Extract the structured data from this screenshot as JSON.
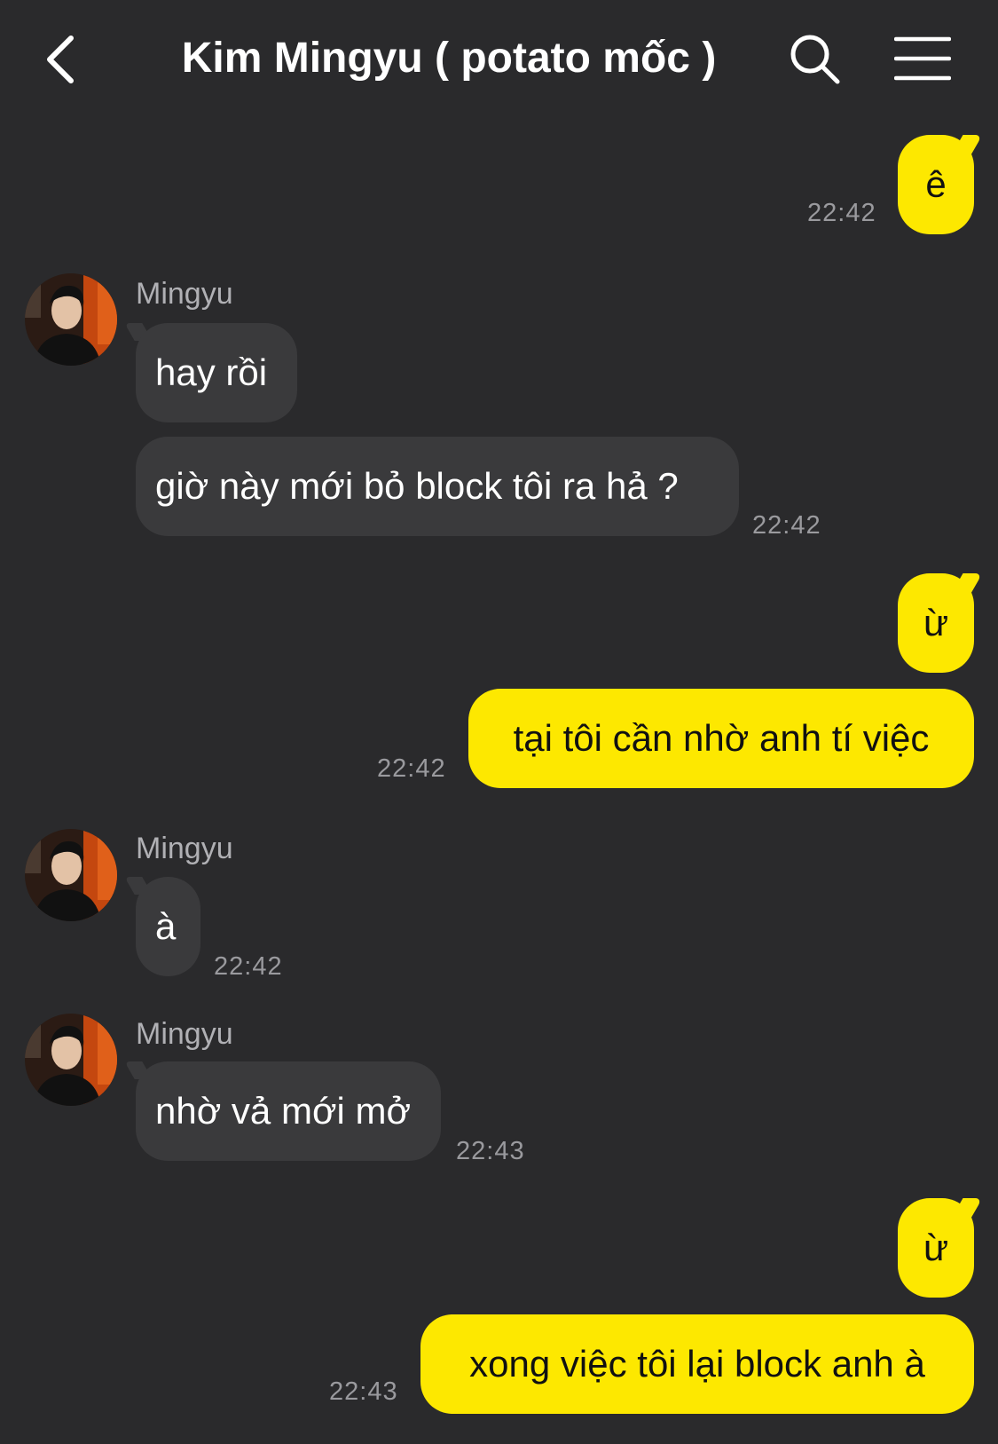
{
  "header": {
    "title": "Kim Mingyu ( potato mốc )"
  },
  "contact": {
    "name": "Mingyu"
  },
  "messages": [
    {
      "from": "me",
      "text": "ê",
      "time": "22:42"
    },
    {
      "from": "them",
      "text": "hay rồi",
      "time": ""
    },
    {
      "from": "them",
      "text": "giờ này mới bỏ block tôi ra hả ?",
      "time": "22:42"
    },
    {
      "from": "me",
      "text": "ừ",
      "time": ""
    },
    {
      "from": "me",
      "text": "tại tôi cần nhờ anh tí việc",
      "time": "22:42"
    },
    {
      "from": "them",
      "text": "à",
      "time": "22:42"
    },
    {
      "from": "them",
      "text": "nhờ vả mới mở",
      "time": "22:43"
    },
    {
      "from": "me",
      "text": "ừ",
      "time": ""
    },
    {
      "from": "me",
      "text": "xong việc tôi lại block anh à",
      "time": "22:43"
    }
  ],
  "icons": {
    "back": "chevron-left-icon",
    "search": "search-icon",
    "menu": "hamburger-menu-icon"
  },
  "colors": {
    "background": "#2a2a2c",
    "my_bubble": "#fde800",
    "their_bubble": "#3a3a3c",
    "timestamp": "#9a9a9e"
  }
}
